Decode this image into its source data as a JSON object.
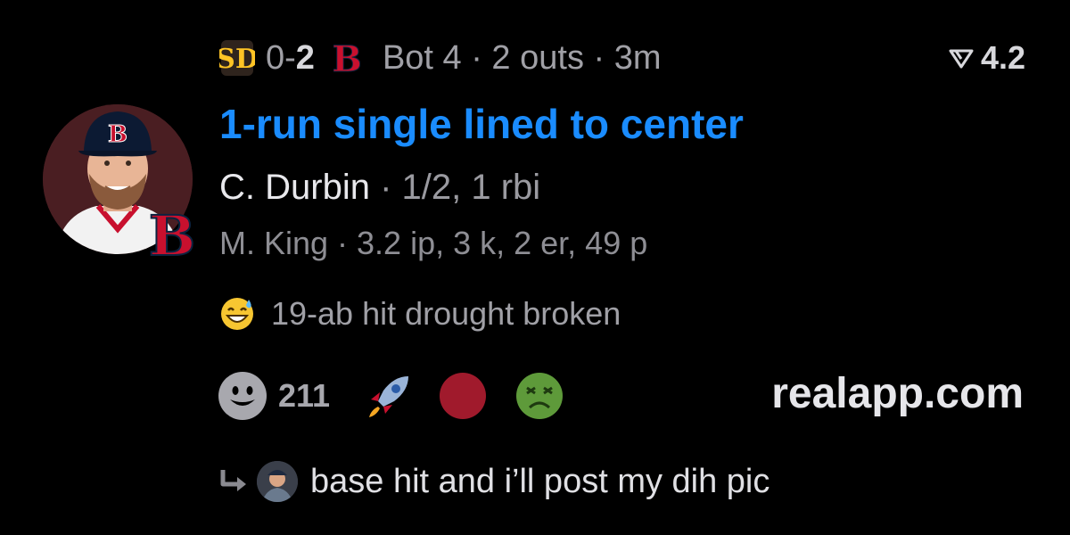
{
  "header": {
    "away_team_icon": "padres-logo-icon",
    "score_away": "0-",
    "score_home": "2",
    "home_team_icon": "red-sox-logo-icon",
    "game_status": "Bot 4 · 2 outs · 3m",
    "odds_icon": "signal-triangle-icon",
    "odds_value": "4.2"
  },
  "play": {
    "title": "1-run single lined to center",
    "batter_name": "C. Durbin",
    "batter_stats": " · 1/2, 1 rbi",
    "pitcher_line": "M. King · 3.2 ip, 3 k, 2 er, 49 p",
    "avatar_icon": "player-photo",
    "avatar_badge_icon": "red-sox-logo-icon"
  },
  "note": {
    "emoji_icon": "sweat-smile-emoji-icon",
    "text": "19-ab hit drought broken"
  },
  "reactions": {
    "add_icon": "smiley-face-icon",
    "count": "211",
    "items": [
      "rocket-emoji-icon",
      "red-circle-icon",
      "sick-face-emoji-icon"
    ]
  },
  "branding": {
    "site": "realapp.com"
  },
  "reply": {
    "arrow_icon": "reply-arrow-icon",
    "avatar_icon": "user-avatar",
    "text": "base hit and i’ll post my dih pic"
  },
  "colors": {
    "background": "#000000",
    "accent_blue": "#1a8cff",
    "red_sox_red": "#c8102e",
    "padres_gold": "#ffc425"
  }
}
